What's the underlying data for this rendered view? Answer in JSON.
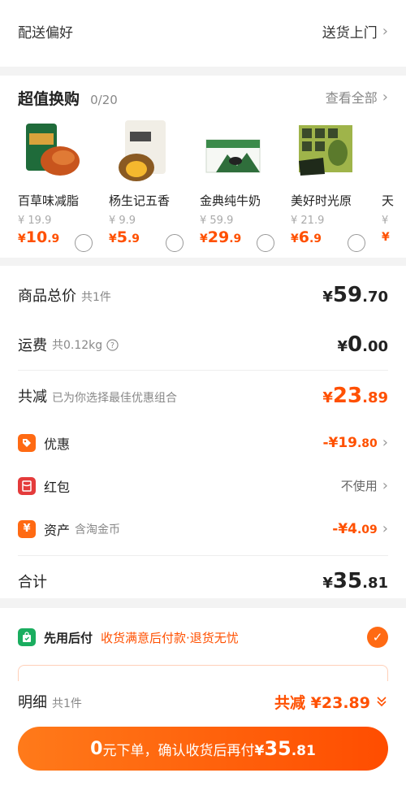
{
  "delivery": {
    "label": "配送偏好",
    "value": "送货上门"
  },
  "bargain": {
    "title": "超值换购",
    "count": "0/20",
    "view_all": "查看全部",
    "items": [
      {
        "name": "百草味减脂",
        "orig": "¥ 19.9",
        "price_int": "10",
        "price_dec": ".9"
      },
      {
        "name": "杨生记五香",
        "orig": "¥ 9.9",
        "price_int": "5",
        "price_dec": ".9"
      },
      {
        "name": "金典纯牛奶",
        "orig": "¥ 59.9",
        "price_int": "29",
        "price_dec": ".9"
      },
      {
        "name": "美好时光原",
        "orig": "¥ 21.9",
        "price_int": "6",
        "price_dec": ".9"
      },
      {
        "name": "天",
        "orig": "¥",
        "price_int": "",
        "price_dec": ""
      }
    ]
  },
  "summary": {
    "goods_label": "商品总价",
    "goods_sub": "共1件",
    "goods_int": "59",
    "goods_dec": ".70",
    "freight_label": "运费",
    "freight_sub": "共0.12kg",
    "freight_int": "0",
    "freight_dec": ".00",
    "reduce_label": "共减",
    "reduce_sub": "已为你选择最佳优惠组合",
    "reduce_int": "23",
    "reduce_dec": ".89",
    "discount_label": "优惠",
    "discount_amt": "-¥19",
    "discount_dec": ".80",
    "redpacket_label": "红包",
    "redpacket_value": "不使用",
    "asset_label": "资产",
    "asset_sub": "含淘金币",
    "asset_amt": "-¥4",
    "asset_dec": ".09",
    "total_label": "合计",
    "total_int": "35",
    "total_dec": ".81",
    "currency": "¥"
  },
  "paylater": {
    "title": "先用后付",
    "subtitle": "收货满意后付款·退货无忧"
  },
  "bottom": {
    "detail_label": "明细",
    "detail_sub": "共1件",
    "reduce_text": "共减 ¥23",
    "reduce_dec": ".89",
    "btn_zero": "0",
    "btn_text": "元下单，确认收货后再付 ",
    "btn_cur": "¥",
    "btn_int": "35",
    "btn_dec": ".81"
  },
  "colors": {
    "accent": "#ff5000",
    "green": "#1aad5f",
    "red": "#e43b3b"
  },
  "icons": [
    "chevron-right-icon",
    "help-circle-icon",
    "tag-icon",
    "red-packet-icon",
    "yen-icon",
    "shopping-bag-check-icon",
    "check-icon",
    "double-chevron-down-icon"
  ]
}
